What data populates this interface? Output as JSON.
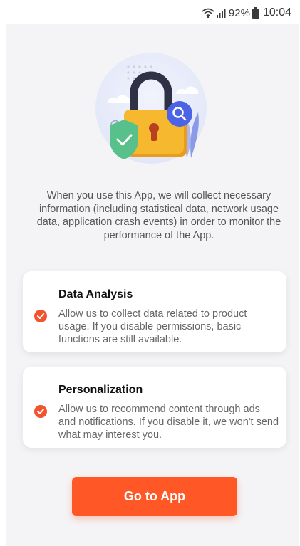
{
  "status_bar": {
    "battery": "92%",
    "time": "10:04",
    "icons": [
      "wifi-icon",
      "signal-icon",
      "battery-icon"
    ]
  },
  "hero_icons": [
    "lock-icon",
    "shield-check-icon",
    "search-icon",
    "plant-icon"
  ],
  "intro_text": "When you use this App, we will collect necessary information (including statistical data, network usage data, application crash events) in order to monitor the performance of the App.",
  "cards": [
    {
      "title": "Data Analysis",
      "text": "Allow us to collect data related to product usage. If you disable permissions, basic functions are still available.",
      "checked": true
    },
    {
      "title": "Personalization",
      "text": "Allow us to recommend content through ads and notifications. If you disable it, we won't send what may interest you.",
      "checked": true
    }
  ],
  "cta_label": "Go to App",
  "colors": {
    "accent": "#ff5726",
    "check": "#f2542d",
    "lock_body": "#f5b82e",
    "lock_shackle": "#2f3146",
    "shield": "#58c08a",
    "search_badge": "#4a63e7",
    "background": "#f4f4f6"
  }
}
